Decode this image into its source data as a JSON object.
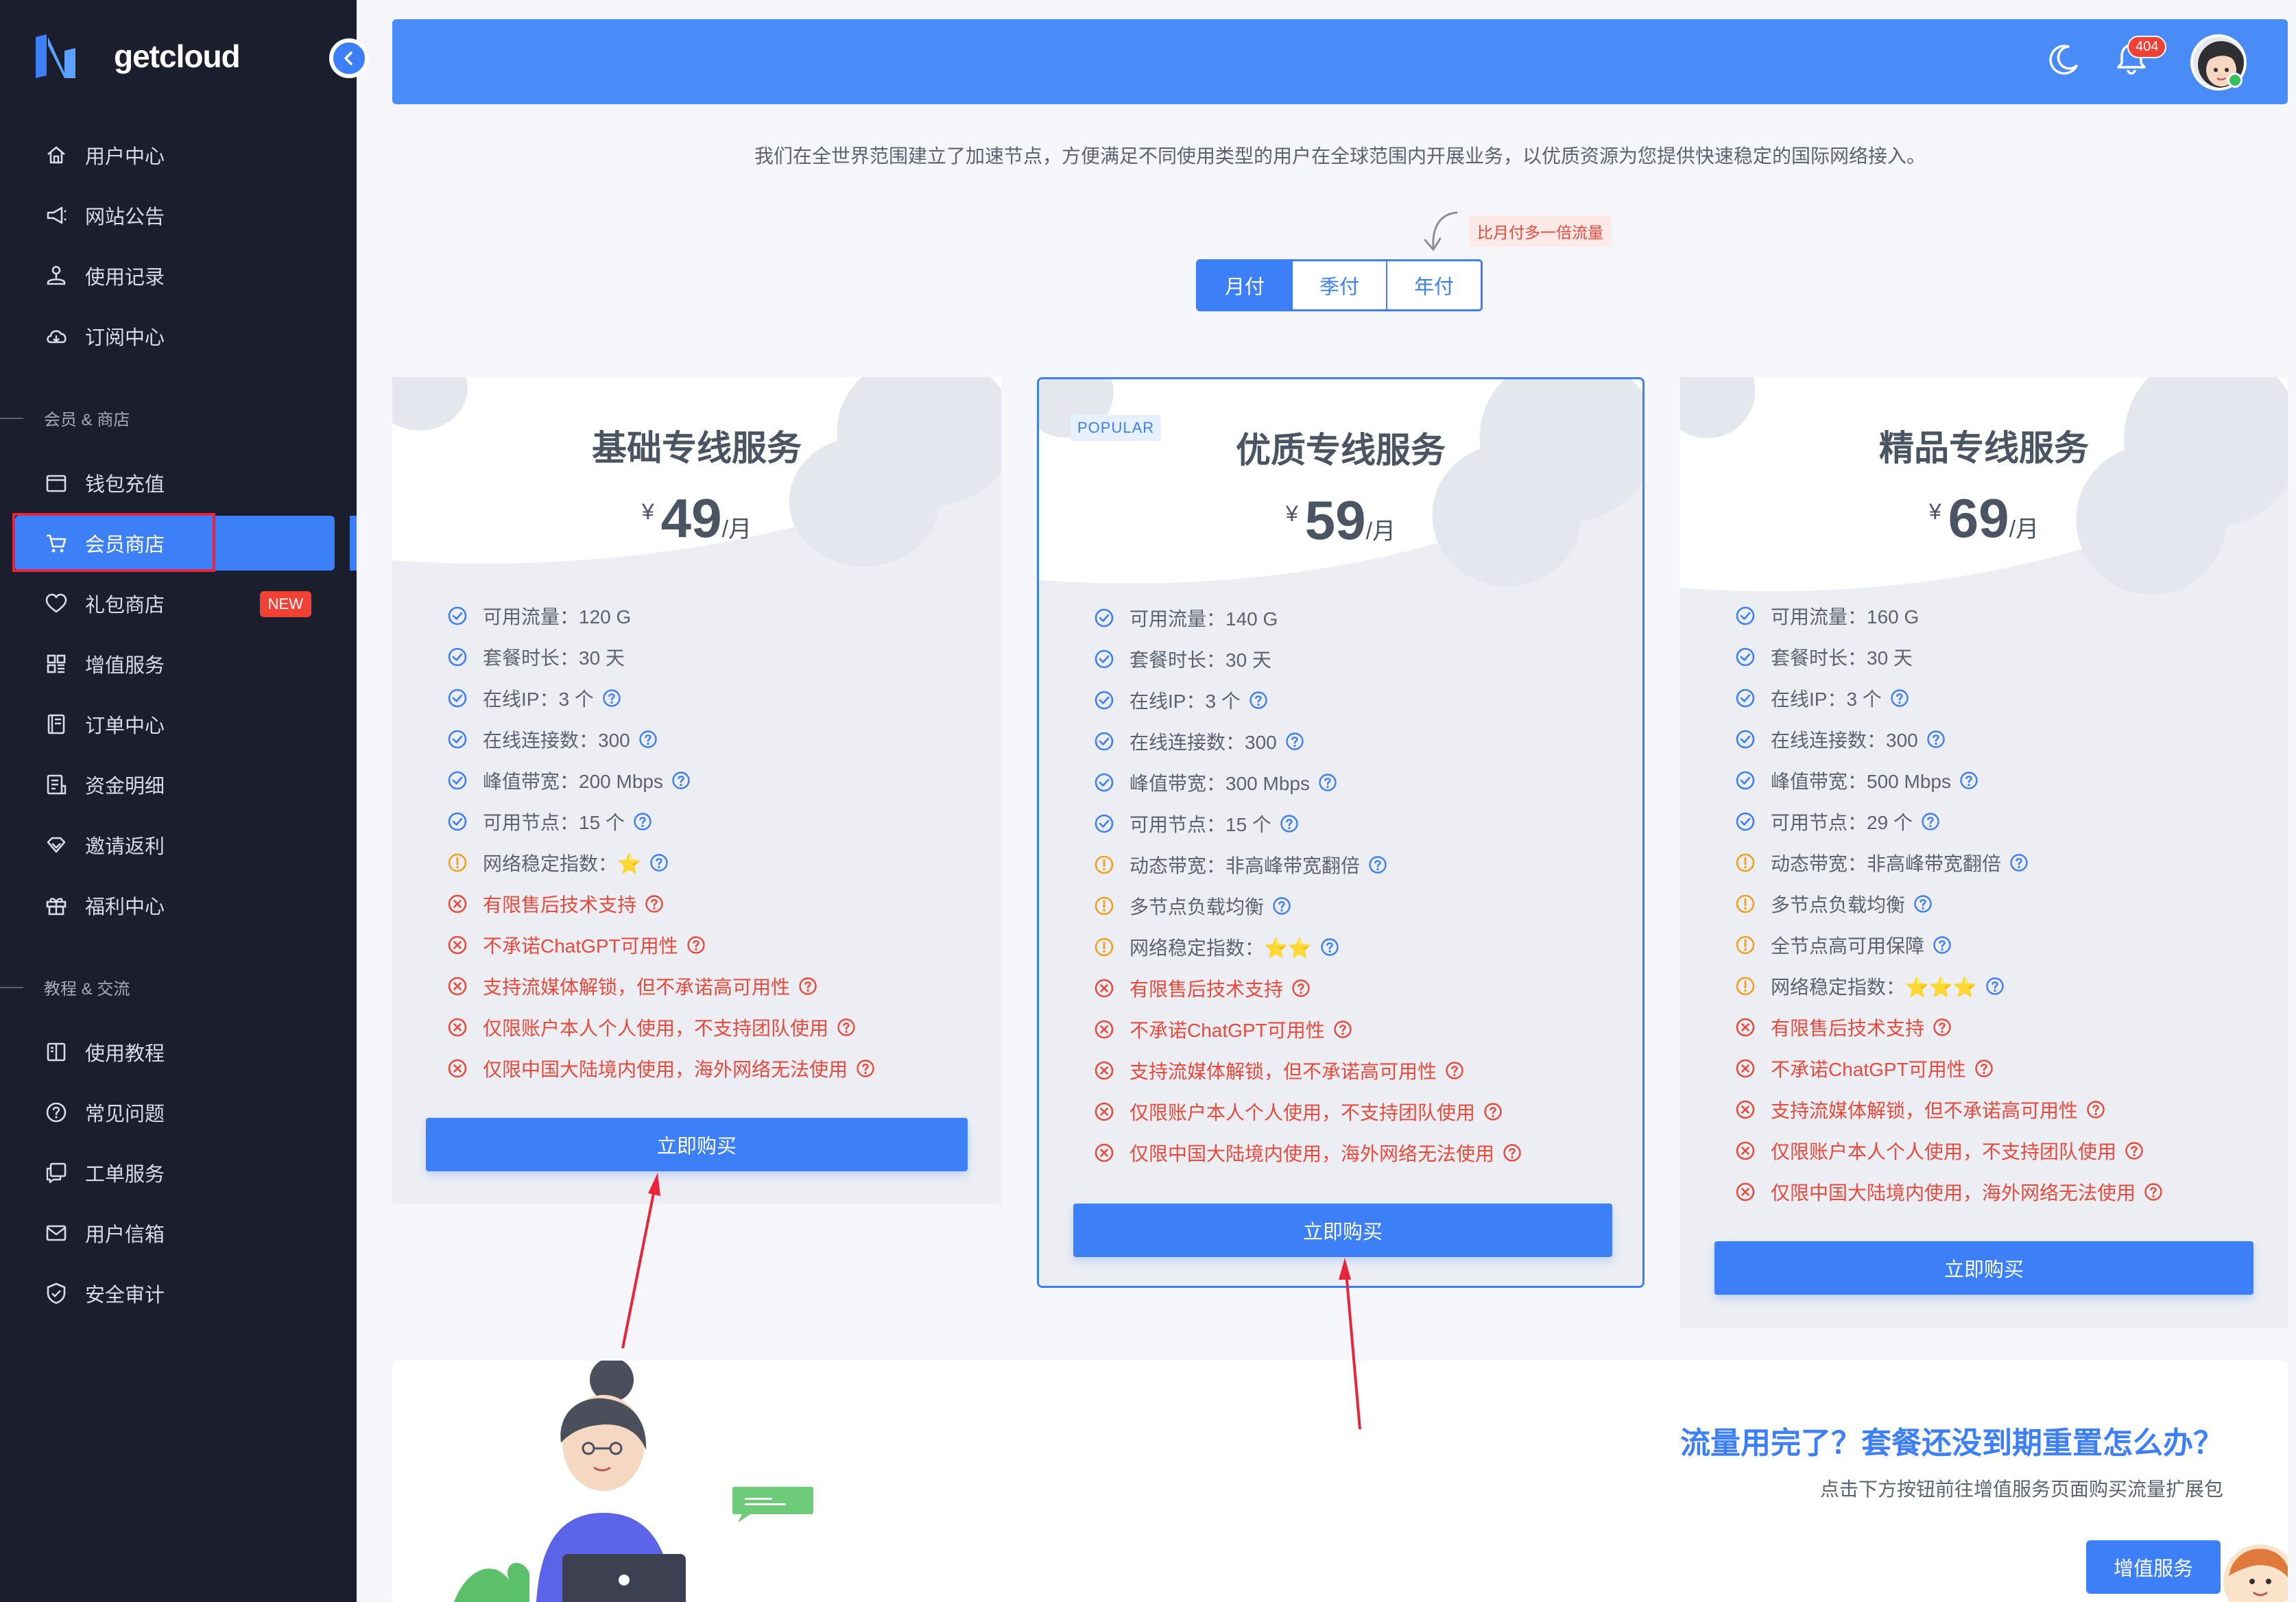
{
  "brand": {
    "name": "getcloud"
  },
  "sidebar": {
    "items": [
      {
        "label": "用户中心",
        "icon": "home-icon"
      },
      {
        "label": "网站公告",
        "icon": "megaphone-icon"
      },
      {
        "label": "使用记录",
        "icon": "usage-icon"
      },
      {
        "label": "订阅中心",
        "icon": "cloud-icon"
      }
    ],
    "section1": "会员 & 商店",
    "items2": [
      {
        "label": "钱包充值",
        "icon": "wallet-icon"
      },
      {
        "label": "会员商店",
        "icon": "cart-icon"
      },
      {
        "label": "礼包商店",
        "icon": "heart-icon",
        "badge": "NEW"
      },
      {
        "label": "增值服务",
        "icon": "grid-icon"
      },
      {
        "label": "订单中心",
        "icon": "orders-icon"
      },
      {
        "label": "资金明细",
        "icon": "ledger-icon"
      },
      {
        "label": "邀请返利",
        "icon": "referral-icon"
      },
      {
        "label": "福利中心",
        "icon": "gift-icon"
      }
    ],
    "section2": "教程 & 交流",
    "items3": [
      {
        "label": "使用教程",
        "icon": "book-icon"
      },
      {
        "label": "常见问题",
        "icon": "question-icon"
      },
      {
        "label": "工单服务",
        "icon": "ticket-icon"
      },
      {
        "label": "用户信箱",
        "icon": "mail-icon"
      },
      {
        "label": "安全审计",
        "icon": "shield-icon"
      }
    ]
  },
  "header": {
    "notification_count": "404"
  },
  "intro": "我们在全世界范围建立了加速节点，方便满足不同使用类型的用户在全球范围内开展业务，以优质资源为您提供快速稳定的国际网络接入。",
  "period": {
    "hint": "比月付多一倍流量",
    "tabs": [
      "月付",
      "季付",
      "年付"
    ],
    "selected": "月付"
  },
  "plans": [
    {
      "title": "基础专线服务",
      "currency": "¥",
      "price": "49",
      "unit": "/月",
      "popular": false,
      "features": [
        {
          "type": "ok",
          "text": "可用流量：120 G",
          "q": false
        },
        {
          "type": "ok",
          "text": "套餐时长：30 天",
          "q": false
        },
        {
          "type": "ok",
          "text": "在线IP：3 个",
          "q": true
        },
        {
          "type": "ok",
          "text": "在线连接数：300",
          "q": true
        },
        {
          "type": "ok",
          "text": "峰值带宽：200 Mbps",
          "q": true
        },
        {
          "type": "ok",
          "text": "可用节点：15 个",
          "q": true
        },
        {
          "type": "warn",
          "text": "网络稳定指数：⭐",
          "q": true
        },
        {
          "type": "bad",
          "text": "有限售后技术支持",
          "q": true
        },
        {
          "type": "bad",
          "text": "不承诺ChatGPT可用性",
          "q": true
        },
        {
          "type": "bad",
          "text": "支持流媒体解锁，但不承诺高可用性",
          "q": true
        },
        {
          "type": "bad",
          "text": "仅限账户本人个人使用，不支持团队使用",
          "q": true
        },
        {
          "type": "bad",
          "text": "仅限中国大陆境内使用，海外网络无法使用",
          "q": true
        }
      ],
      "buy": "立即购买"
    },
    {
      "title": "优质专线服务",
      "currency": "¥",
      "price": "59",
      "unit": "/月",
      "popular": true,
      "popular_label": "POPULAR",
      "features": [
        {
          "type": "ok",
          "text": "可用流量：140 G",
          "q": false
        },
        {
          "type": "ok",
          "text": "套餐时长：30 天",
          "q": false
        },
        {
          "type": "ok",
          "text": "在线IP：3 个",
          "q": true
        },
        {
          "type": "ok",
          "text": "在线连接数：300",
          "q": true
        },
        {
          "type": "ok",
          "text": "峰值带宽：300 Mbps",
          "q": true
        },
        {
          "type": "ok",
          "text": "可用节点：15 个",
          "q": true
        },
        {
          "type": "warn",
          "text": "动态带宽：非高峰带宽翻倍",
          "q": true
        },
        {
          "type": "warn",
          "text": "多节点负载均衡",
          "q": true
        },
        {
          "type": "warn",
          "text": "网络稳定指数：⭐⭐",
          "q": true
        },
        {
          "type": "bad",
          "text": "有限售后技术支持",
          "q": true
        },
        {
          "type": "bad",
          "text": "不承诺ChatGPT可用性",
          "q": true
        },
        {
          "type": "bad",
          "text": "支持流媒体解锁，但不承诺高可用性",
          "q": true
        },
        {
          "type": "bad",
          "text": "仅限账户本人个人使用，不支持团队使用",
          "q": true
        },
        {
          "type": "bad",
          "text": "仅限中国大陆境内使用，海外网络无法使用",
          "q": true
        }
      ],
      "buy": "立即购买"
    },
    {
      "title": "精品专线服务",
      "currency": "¥",
      "price": "69",
      "unit": "/月",
      "popular": false,
      "features": [
        {
          "type": "ok",
          "text": "可用流量：160 G",
          "q": false
        },
        {
          "type": "ok",
          "text": "套餐时长：30 天",
          "q": false
        },
        {
          "type": "ok",
          "text": "在线IP：3 个",
          "q": true
        },
        {
          "type": "ok",
          "text": "在线连接数：300",
          "q": true
        },
        {
          "type": "ok",
          "text": "峰值带宽：500 Mbps",
          "q": true
        },
        {
          "type": "ok",
          "text": "可用节点：29 个",
          "q": true
        },
        {
          "type": "warn",
          "text": "动态带宽：非高峰带宽翻倍",
          "q": true
        },
        {
          "type": "warn",
          "text": "多节点负载均衡",
          "q": true
        },
        {
          "type": "warn",
          "text": "全节点高可用保障",
          "q": true
        },
        {
          "type": "warn",
          "text": "网络稳定指数：⭐⭐⭐",
          "q": true
        },
        {
          "type": "bad",
          "text": "有限售后技术支持",
          "q": true
        },
        {
          "type": "bad",
          "text": "不承诺ChatGPT可用性",
          "q": true
        },
        {
          "type": "bad",
          "text": "支持流媒体解锁，但不承诺高可用性",
          "q": true
        },
        {
          "type": "bad",
          "text": "仅限账户本人个人使用，不支持团队使用",
          "q": true
        },
        {
          "type": "bad",
          "text": "仅限中国大陆境内使用，海外网络无法使用",
          "q": true
        }
      ],
      "buy": "立即购买"
    }
  ],
  "banner": {
    "title": "流量用完了？套餐还没到期重置怎么办？",
    "subtitle": "点击下方按钮前往增值服务页面购买流量扩展包",
    "button": "增值服务"
  },
  "colors": {
    "accent": "#3d7ff6",
    "sidebar": "#1b1e2c",
    "danger": "#e84a3c",
    "warning": "#f0a020"
  }
}
